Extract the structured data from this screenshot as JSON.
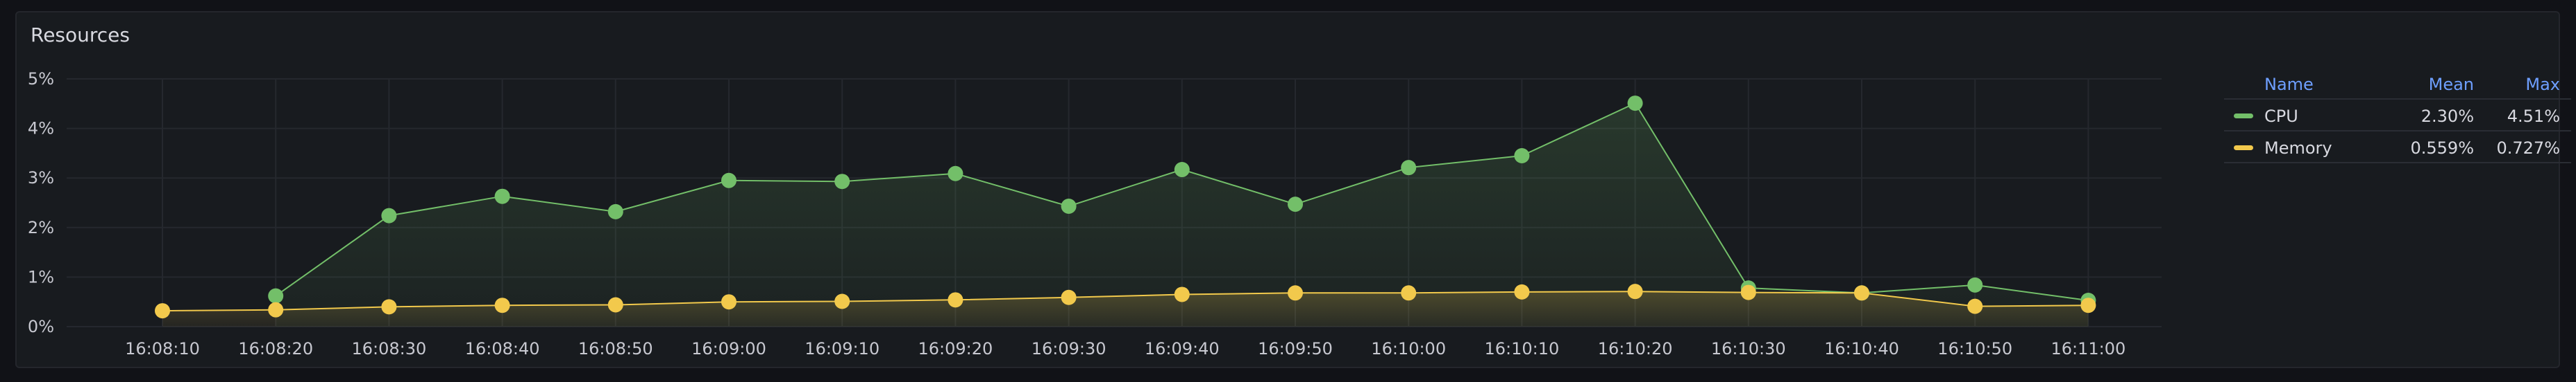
{
  "panel": {
    "title": "Resources"
  },
  "legend": {
    "headers": {
      "name": "Name",
      "mean": "Mean",
      "max": "Max"
    },
    "rows": [
      {
        "name": "CPU",
        "color": "#73bf69",
        "mean": "2.30%",
        "max": "4.51%"
      },
      {
        "name": "Memory",
        "color": "#f2c94c",
        "mean": "0.559%",
        "max": "0.727%"
      }
    ]
  },
  "chart_data": {
    "type": "area",
    "title": "Resources",
    "xlabel": "",
    "ylabel": "",
    "ylim": [
      0,
      5
    ],
    "y_ticks": [
      "0%",
      "1%",
      "2%",
      "3%",
      "4%",
      "5%"
    ],
    "x_ticks": [
      "16:08:10",
      "16:08:20",
      "16:08:30",
      "16:08:40",
      "16:08:50",
      "16:09:00",
      "16:09:10",
      "16:09:20",
      "16:09:30",
      "16:09:40",
      "16:09:50",
      "16:10:00",
      "16:10:10",
      "16:10:20",
      "16:10:30",
      "16:10:40",
      "16:10:50",
      "16:11:00"
    ],
    "grid": true,
    "legend_position": "right",
    "series": [
      {
        "name": "CPU",
        "color": "#73bf69",
        "x": [
          "16:08:20",
          "16:08:30",
          "16:08:40",
          "16:08:50",
          "16:09:00",
          "16:09:10",
          "16:09:20",
          "16:09:30",
          "16:09:40",
          "16:09:50",
          "16:10:00",
          "16:10:10",
          "16:10:20",
          "16:10:30",
          "16:10:40",
          "16:10:50",
          "16:11:00"
        ],
        "values": [
          0.62,
          2.24,
          2.63,
          2.32,
          2.95,
          2.93,
          3.09,
          2.43,
          3.17,
          2.47,
          3.21,
          3.45,
          4.51,
          0.78,
          0.68,
          0.84,
          0.53
        ]
      },
      {
        "name": "Memory",
        "color": "#f2c94c",
        "x": [
          "16:08:10",
          "16:08:20",
          "16:08:30",
          "16:08:40",
          "16:08:50",
          "16:09:00",
          "16:09:10",
          "16:09:20",
          "16:09:30",
          "16:09:40",
          "16:09:50",
          "16:10:00",
          "16:10:10",
          "16:10:20",
          "16:10:30",
          "16:10:40",
          "16:10:50",
          "16:11:00"
        ],
        "values": [
          0.32,
          0.34,
          0.4,
          0.43,
          0.44,
          0.5,
          0.51,
          0.54,
          0.59,
          0.65,
          0.68,
          0.68,
          0.7,
          0.71,
          0.69,
          0.68,
          0.41,
          0.43
        ]
      }
    ]
  }
}
